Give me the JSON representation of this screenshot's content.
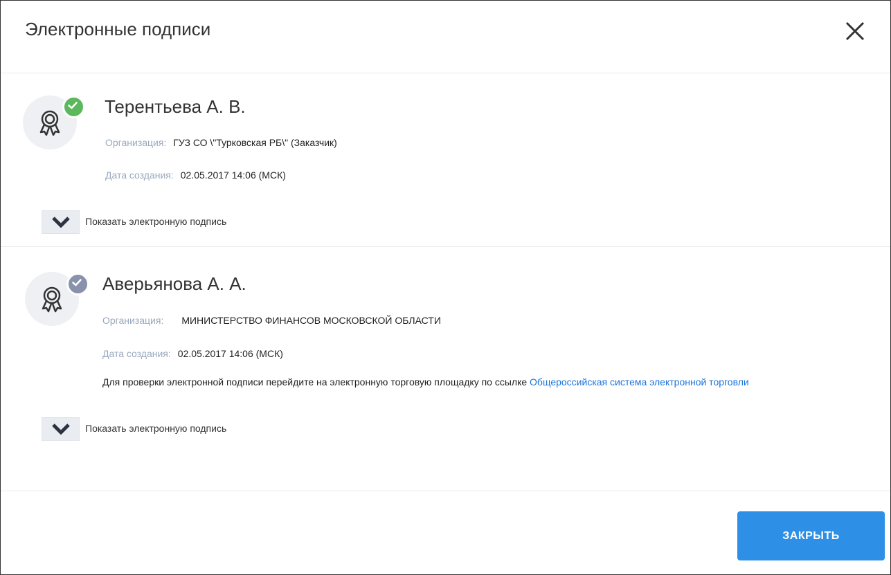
{
  "dialog": {
    "title": "Электронные подписи",
    "close_button_label": "ЗАКРЫТЬ"
  },
  "signatures": [
    {
      "name": "Терентьева А. В.",
      "status": "verified",
      "status_color": "#5cb85c",
      "org_label": "Организация:",
      "org_value": "ГУЗ СО \\\"Турковская РБ\\\" (Заказчик)",
      "date_label": "Дата создания:",
      "date_value": "02.05.2017 14:06 (МСК)",
      "toggle_label": "Показать электронную подпись"
    },
    {
      "name": "Аверьянова А. А.",
      "status": "unverified",
      "status_color": "#8992ab",
      "org_label": "Организация:",
      "org_value": "МИНИСТЕРСТВО ФИНАНСОВ МОСКОВСКОЙ ОБЛАСТИ",
      "date_label": "Дата создания:",
      "date_value": "02.05.2017 14:06 (МСК)",
      "note_text": "Для проверки электронной подписи перейдите на электронную торговую площадку по ссылке ",
      "note_link": "Общероссийская система электронной торговли",
      "toggle_label": "Показать электронную подпись"
    }
  ],
  "colors": {
    "accent": "#2d8fe6",
    "link": "#1a73d9",
    "label": "#9aa8bd"
  },
  "icons": {
    "close": "close-icon",
    "certificate": "certificate-ribbon-icon",
    "check": "check-icon",
    "chevron": "chevron-down-icon"
  }
}
